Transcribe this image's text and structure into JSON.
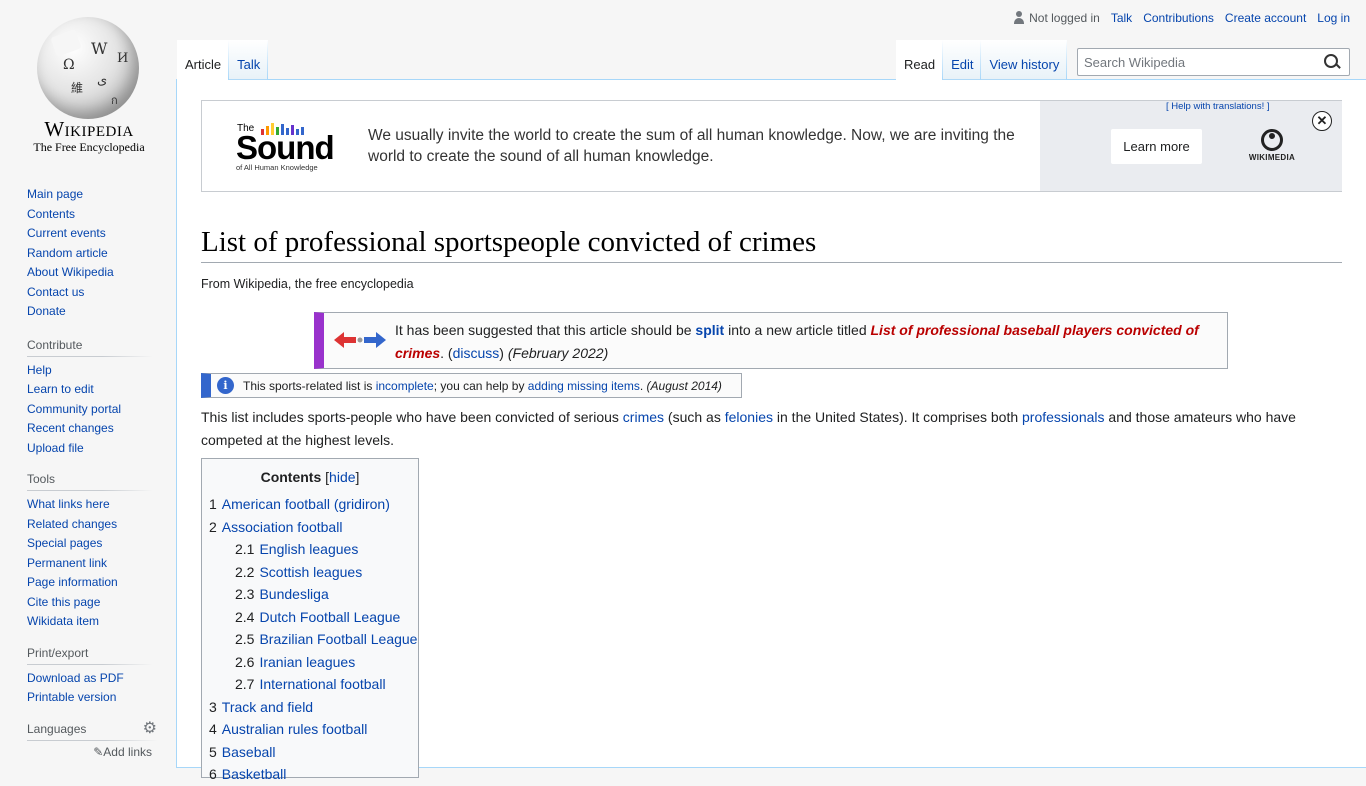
{
  "logo": {
    "wordmark": "Wikipedia",
    "tagline": "The Free Encyclopedia"
  },
  "personal": {
    "not_logged_in": "Not logged in",
    "talk": "Talk",
    "contributions": "Contributions",
    "create_account": "Create account",
    "login": "Log in"
  },
  "tabs": {
    "article": "Article",
    "talk": "Talk",
    "read": "Read",
    "edit": "Edit",
    "view_history": "View history"
  },
  "search": {
    "placeholder": "Search Wikipedia"
  },
  "sidebar": {
    "navigation": [
      "Main page",
      "Contents",
      "Current events",
      "Random article",
      "About Wikipedia",
      "Contact us",
      "Donate"
    ],
    "contribute_heading": "Contribute",
    "contribute": [
      "Help",
      "Learn to edit",
      "Community portal",
      "Recent changes",
      "Upload file"
    ],
    "tools_heading": "Tools",
    "tools": [
      "What links here",
      "Related changes",
      "Special pages",
      "Permanent link",
      "Page information",
      "Cite this page",
      "Wikidata item"
    ],
    "print_heading": "Print/export",
    "print": [
      "Download as PDF",
      "Printable version"
    ],
    "languages_heading": "Languages",
    "add_links": "Add links"
  },
  "banner": {
    "logo_the": "The",
    "logo_sound": "Sound",
    "logo_sub": "of All Human Knowledge",
    "text": "We usually invite the world to create the sum of all human knowledge. Now, we are inviting the world to create the sound of all human knowledge.",
    "help_translations": "[ Help with translations! ]",
    "learn_more": "Learn more",
    "wikimedia": "WIKIMEDIA",
    "close": "✕"
  },
  "page": {
    "title": "List of professional sportspeople convicted of crimes",
    "from": "From Wikipedia, the free encyclopedia"
  },
  "split_notice": {
    "pre": "It has been suggested that this article should be ",
    "split": "split",
    "mid": " into a new article titled ",
    "target": "List of professional baseball players convicted of crimes",
    "dot": ". (",
    "discuss": "discuss",
    "close_paren": ") ",
    "date": "(February 2022)"
  },
  "incomplete_notice": {
    "pre": "This sports-related list is ",
    "incomplete": "incomplete",
    "mid": "; you can help by ",
    "adding": "adding missing items",
    "dot": ". ",
    "date": "(August 2014)"
  },
  "intro": {
    "p1": "This list includes sports-people who have been convicted of serious ",
    "crimes": "crimes",
    "p2": " (such as ",
    "felonies": "felonies",
    "p3": " in the United States). It comprises both ",
    "professionals": "professionals",
    "p4": " and those amateurs who have competed at the highest levels."
  },
  "toc": {
    "title": "Contents",
    "hide": "hide",
    "items": [
      {
        "num": "1",
        "text": "American football (gridiron)"
      },
      {
        "num": "2",
        "text": "Association football"
      },
      {
        "num": "2.1",
        "text": "English leagues"
      },
      {
        "num": "2.2",
        "text": "Scottish leagues"
      },
      {
        "num": "2.3",
        "text": "Bundesliga"
      },
      {
        "num": "2.4",
        "text": "Dutch Football League"
      },
      {
        "num": "2.5",
        "text": "Brazilian Football League"
      },
      {
        "num": "2.6",
        "text": "Iranian leagues"
      },
      {
        "num": "2.7",
        "text": "International football"
      },
      {
        "num": "3",
        "text": "Track and field"
      },
      {
        "num": "4",
        "text": "Australian rules football"
      },
      {
        "num": "5",
        "text": "Baseball"
      },
      {
        "num": "6",
        "text": "Basketball"
      }
    ]
  },
  "colors": {
    "link": "#0645ad",
    "split_border": "#9932cc",
    "info_border": "#3366cc",
    "red_link": "#ba0000"
  }
}
